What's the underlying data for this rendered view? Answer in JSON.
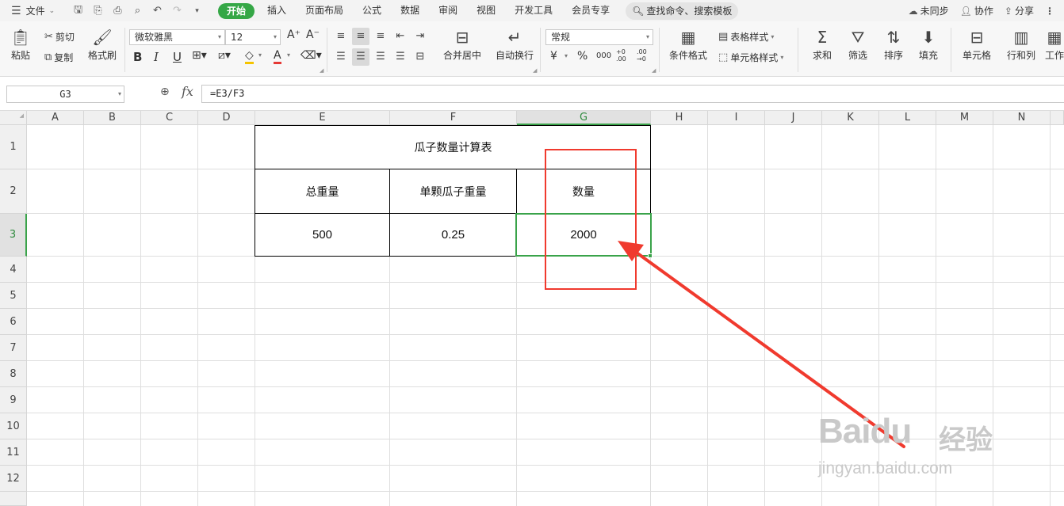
{
  "menubar": {
    "file_label": "文件",
    "tabs": [
      "开始",
      "插入",
      "页面布局",
      "公式",
      "数据",
      "审阅",
      "视图",
      "开发工具",
      "会员专享"
    ],
    "search_label": "查找命令、搜索模板",
    "right": {
      "sync": "未同步",
      "collab": "协作",
      "share": "分享"
    }
  },
  "ribbon": {
    "paste": "粘贴",
    "cut": "剪切",
    "copy": "复制",
    "format_painter": "格式刷",
    "font_name": "微软雅黑",
    "font_size": "12",
    "bold": "B",
    "italic": "I",
    "underline": "U",
    "merge_center": "合并居中",
    "wrap_text": "自动换行",
    "number_format": "常规",
    "currency": "¥",
    "percent": "%",
    "thousands": "000",
    "inc_decimal": "+0 .00",
    "dec_decimal": ".00 →0",
    "conditional_format": "条件格式",
    "table_style": "表格样式",
    "cell_style": "单元格样式",
    "sum": "求和",
    "filter": "筛选",
    "sort": "排序",
    "fill": "填充",
    "cell": "单元格",
    "row_col": "行和列",
    "worksheet": "工作"
  },
  "formula_bar": {
    "name_box": "G3",
    "fx": "fx",
    "formula": "=E3/F3"
  },
  "sheet": {
    "columns": [
      "A",
      "B",
      "C",
      "D",
      "E",
      "F",
      "G",
      "H",
      "I",
      "J",
      "K",
      "L",
      "M",
      "N"
    ],
    "rows": [
      "1",
      "2",
      "3",
      "4",
      "5",
      "6",
      "7",
      "8",
      "9",
      "10",
      "11",
      "12"
    ],
    "selected_cell": "G3",
    "table_title": "瓜子数量计算表",
    "headers": [
      "总重量",
      "单颗瓜子重量",
      "数量"
    ],
    "values": [
      "500",
      "0.25",
      "2000"
    ]
  },
  "watermark": {
    "brand": "Baidu",
    "cn": "经验",
    "url": "jingyan.baidu.com"
  },
  "colors": {
    "accent": "#35a746",
    "annotation": "#f03a2e",
    "selection": "#3aa34a"
  }
}
